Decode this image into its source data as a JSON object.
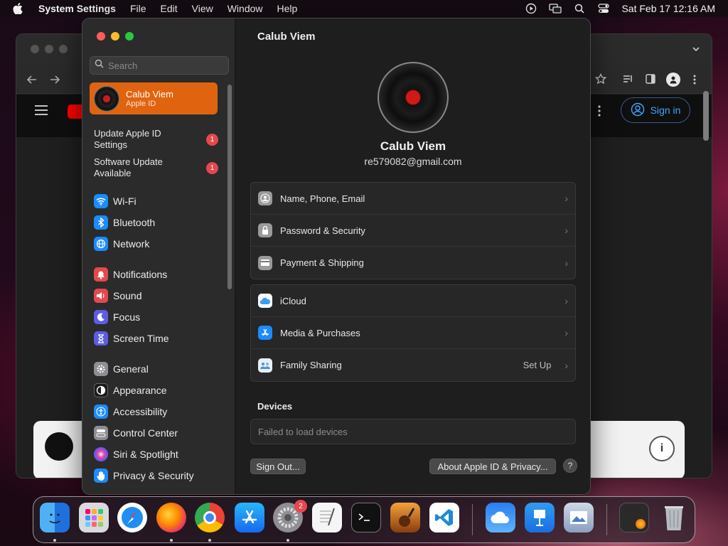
{
  "menubar": {
    "app": "System Settings",
    "items": [
      "File",
      "Edit",
      "View",
      "Window",
      "Help"
    ],
    "clock": "Sat Feb 17  12:16 AM"
  },
  "browser": {
    "signin_label": "Sign in"
  },
  "window": {
    "title": "Calub Viem",
    "search_placeholder": "Search",
    "account": {
      "name": "Calub Viem",
      "subtitle": "Apple ID"
    },
    "notices": [
      {
        "label": "Update Apple ID Settings",
        "badge": "1"
      },
      {
        "label": "Software Update Available",
        "badge": "1"
      }
    ],
    "sidebar": [
      {
        "label": "Wi-Fi",
        "icon": "wifi-icon",
        "color": "#1a8cff"
      },
      {
        "label": "Bluetooth",
        "icon": "bluetooth-icon",
        "color": "#1a8cff"
      },
      {
        "label": "Network",
        "icon": "globe-icon",
        "color": "#1a8cff"
      },
      {
        "label": "Notifications",
        "icon": "bell-icon",
        "color": "#e5484d"
      },
      {
        "label": "Sound",
        "icon": "speaker-icon",
        "color": "#e5484d"
      },
      {
        "label": "Focus",
        "icon": "moon-icon",
        "color": "#5e5ce6"
      },
      {
        "label": "Screen Time",
        "icon": "hourglass-icon",
        "color": "#5e5ce6"
      },
      {
        "label": "General",
        "icon": "gear-icon",
        "color": "#8e8e93"
      },
      {
        "label": "Appearance",
        "icon": "appearance-icon",
        "color": "#1c1c1e"
      },
      {
        "label": "Accessibility",
        "icon": "accessibility-icon",
        "color": "#1a8cff"
      },
      {
        "label": "Control Center",
        "icon": "toggles-icon",
        "color": "#8e8e93"
      },
      {
        "label": "Siri & Spotlight",
        "icon": "siri-icon",
        "color": "#b04be0"
      },
      {
        "label": "Privacy & Security",
        "icon": "hand-icon",
        "color": "#1a8cff"
      }
    ],
    "profile": {
      "name": "Calub Viem",
      "email": "re579082@gmail.com"
    },
    "group1": [
      {
        "label": "Name, Phone, Email",
        "icon": "person-icon"
      },
      {
        "label": "Password & Security",
        "icon": "lock-icon"
      },
      {
        "label": "Payment & Shipping",
        "icon": "card-icon"
      }
    ],
    "group2": [
      {
        "label": "iCloud",
        "icon": "cloud-icon",
        "value": ""
      },
      {
        "label": "Media & Purchases",
        "icon": "appstore-icon",
        "value": ""
      },
      {
        "label": "Family Sharing",
        "icon": "family-icon",
        "value": "Set Up"
      }
    ],
    "devices_heading": "Devices",
    "devices_status": "Failed to load devices",
    "signout_label": "Sign Out...",
    "about_label": "About Apple ID & Privacy...",
    "help_label": "?"
  },
  "dock": {
    "apps": [
      "Finder",
      "Launchpad",
      "Safari",
      "Firefox",
      "Chrome",
      "App Store",
      "System Settings",
      "TextEdit",
      "Terminal",
      "GarageBand",
      "Visual Studio Code",
      "Weather",
      "Keynote",
      "Preview",
      "Downloads",
      "Trash"
    ],
    "settings_badge": "2"
  }
}
